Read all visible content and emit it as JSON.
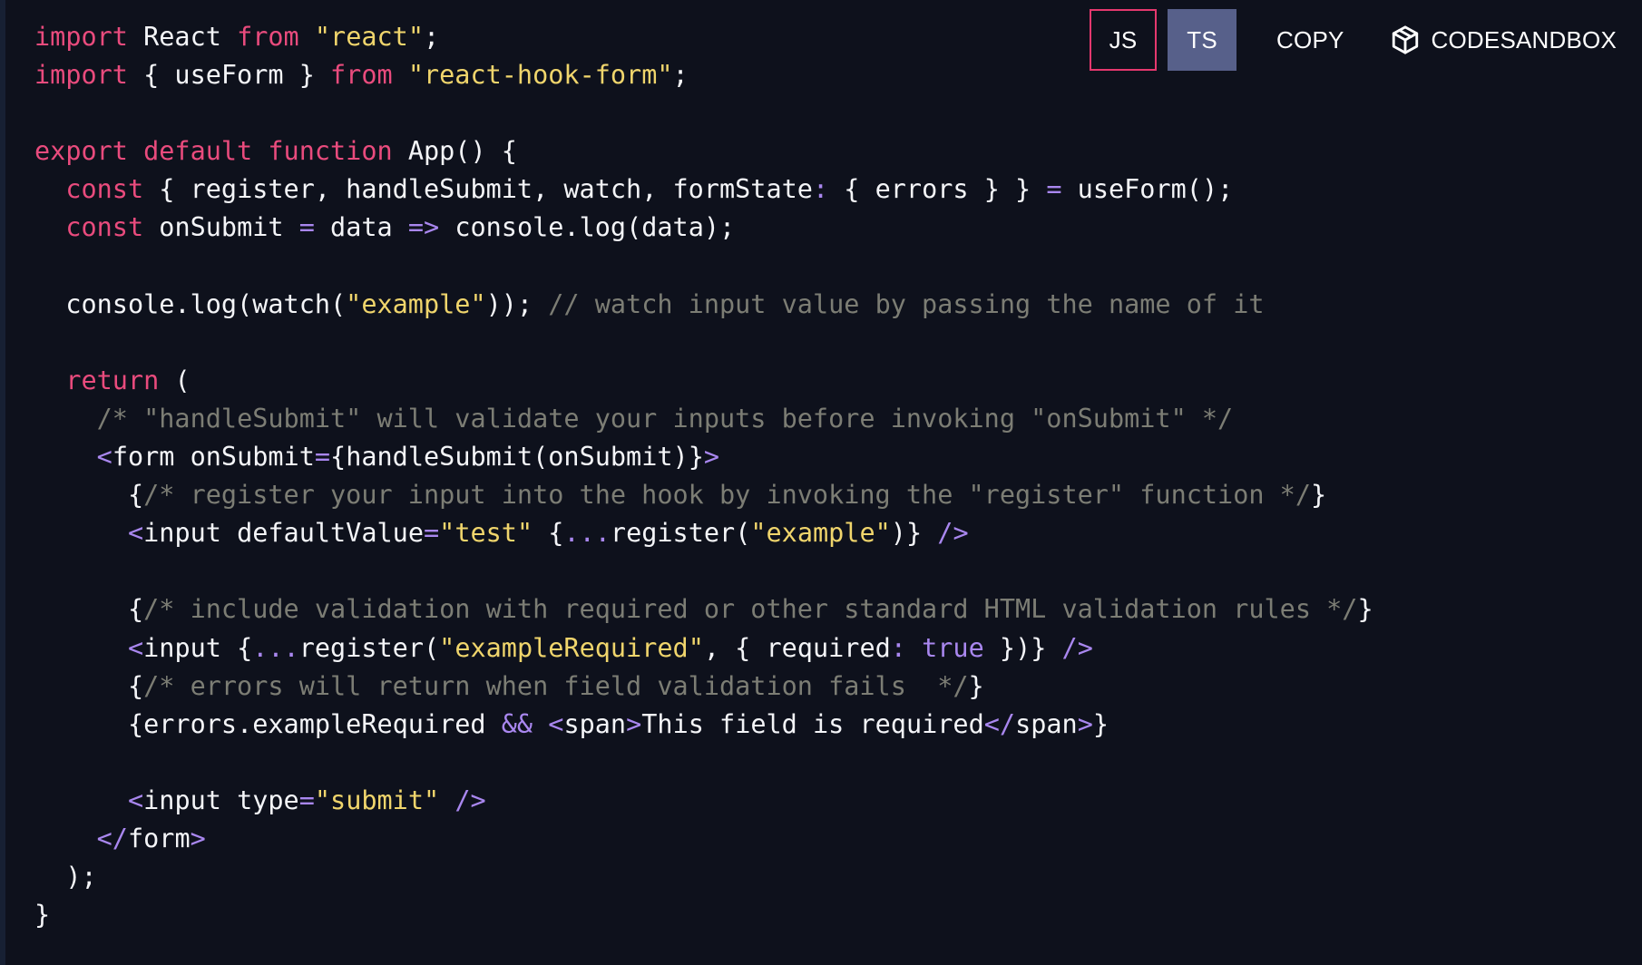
{
  "toolbar": {
    "js_label": "JS",
    "ts_label": "TS",
    "copy_label": "COPY",
    "codesandbox_label": "CODESANDBOX"
  },
  "code": {
    "language": "jsx",
    "lines": [
      [
        [
          "k",
          "import"
        ],
        [
          "t",
          " React "
        ],
        [
          "k",
          "from"
        ],
        [
          "t",
          " "
        ],
        [
          "s",
          "\"react\""
        ],
        [
          "t",
          ";"
        ]
      ],
      [
        [
          "k",
          "import"
        ],
        [
          "t",
          " { useForm } "
        ],
        [
          "k",
          "from"
        ],
        [
          "t",
          " "
        ],
        [
          "s",
          "\"react-hook-form\""
        ],
        [
          "t",
          ";"
        ]
      ],
      [],
      [
        [
          "k",
          "export default function"
        ],
        [
          "t",
          " App() {"
        ]
      ],
      [
        [
          "t",
          "  "
        ],
        [
          "k",
          "const"
        ],
        [
          "t",
          " { register, handleSubmit, watch, formState"
        ],
        [
          "p",
          ":"
        ],
        [
          "t",
          " { errors } } "
        ],
        [
          "p",
          "="
        ],
        [
          "t",
          " useForm();"
        ]
      ],
      [
        [
          "t",
          "  "
        ],
        [
          "k",
          "const"
        ],
        [
          "t",
          " onSubmit "
        ],
        [
          "p",
          "="
        ],
        [
          "t",
          " data "
        ],
        [
          "p",
          "=>"
        ],
        [
          "t",
          " console.log(data);"
        ]
      ],
      [],
      [
        [
          "t",
          "  console.log(watch("
        ],
        [
          "s",
          "\"example\""
        ],
        [
          "t",
          "));"
        ],
        [
          "c",
          " // watch input value by passing the name of it"
        ]
      ],
      [],
      [
        [
          "t",
          "  "
        ],
        [
          "k",
          "return"
        ],
        [
          "t",
          " ("
        ]
      ],
      [
        [
          "t",
          "    "
        ],
        [
          "c",
          "/* \"handleSubmit\" will validate your inputs before invoking \"onSubmit\" */"
        ]
      ],
      [
        [
          "t",
          "    "
        ],
        [
          "p",
          "<"
        ],
        [
          "t",
          "form onSubmit"
        ],
        [
          "p",
          "="
        ],
        [
          "t",
          "{handleSubmit(onSubmit)}"
        ],
        [
          "p",
          ">"
        ]
      ],
      [
        [
          "t",
          "      {"
        ],
        [
          "c",
          "/* register your input into the hook by invoking the \"register\" function */"
        ],
        [
          "t",
          "}"
        ]
      ],
      [
        [
          "t",
          "      "
        ],
        [
          "p",
          "<"
        ],
        [
          "t",
          "input defaultValue"
        ],
        [
          "p",
          "="
        ],
        [
          "s",
          "\"test\""
        ],
        [
          "t",
          " {"
        ],
        [
          "p",
          "..."
        ],
        [
          "t",
          "register("
        ],
        [
          "s",
          "\"example\""
        ],
        [
          "t",
          ")} "
        ],
        [
          "p",
          "/>"
        ]
      ],
      [],
      [
        [
          "t",
          "      {"
        ],
        [
          "c",
          "/* include validation with required or other standard HTML validation rules */"
        ],
        [
          "t",
          "}"
        ]
      ],
      [
        [
          "t",
          "      "
        ],
        [
          "p",
          "<"
        ],
        [
          "t",
          "input {"
        ],
        [
          "p",
          "..."
        ],
        [
          "t",
          "register("
        ],
        [
          "s",
          "\"exampleRequired\""
        ],
        [
          "t",
          ", { required"
        ],
        [
          "p",
          ":"
        ],
        [
          "t",
          " "
        ],
        [
          "p",
          "true"
        ],
        [
          "t",
          " })} "
        ],
        [
          "p",
          "/>"
        ]
      ],
      [
        [
          "t",
          "      {"
        ],
        [
          "c",
          "/* errors will return when field validation fails  */"
        ],
        [
          "t",
          "}"
        ]
      ],
      [
        [
          "t",
          "      {errors.exampleRequired "
        ],
        [
          "p",
          "&&"
        ],
        [
          "t",
          " "
        ],
        [
          "p",
          "<"
        ],
        [
          "t",
          "span"
        ],
        [
          "p",
          ">"
        ],
        [
          "t",
          "This field is required"
        ],
        [
          "p",
          "</"
        ],
        [
          "t",
          "span"
        ],
        [
          "p",
          ">"
        ],
        [
          "t",
          "}"
        ]
      ],
      [],
      [
        [
          "t",
          "      "
        ],
        [
          "p",
          "<"
        ],
        [
          "t",
          "input type"
        ],
        [
          "p",
          "="
        ],
        [
          "s",
          "\"submit\""
        ],
        [
          "t",
          " "
        ],
        [
          "p",
          "/>"
        ]
      ],
      [
        [
          "t",
          "    "
        ],
        [
          "p",
          "</"
        ],
        [
          "t",
          "form"
        ],
        [
          "p",
          ">"
        ]
      ],
      [
        [
          "t",
          "  );"
        ]
      ],
      [
        [
          "t",
          "}"
        ]
      ]
    ]
  }
}
